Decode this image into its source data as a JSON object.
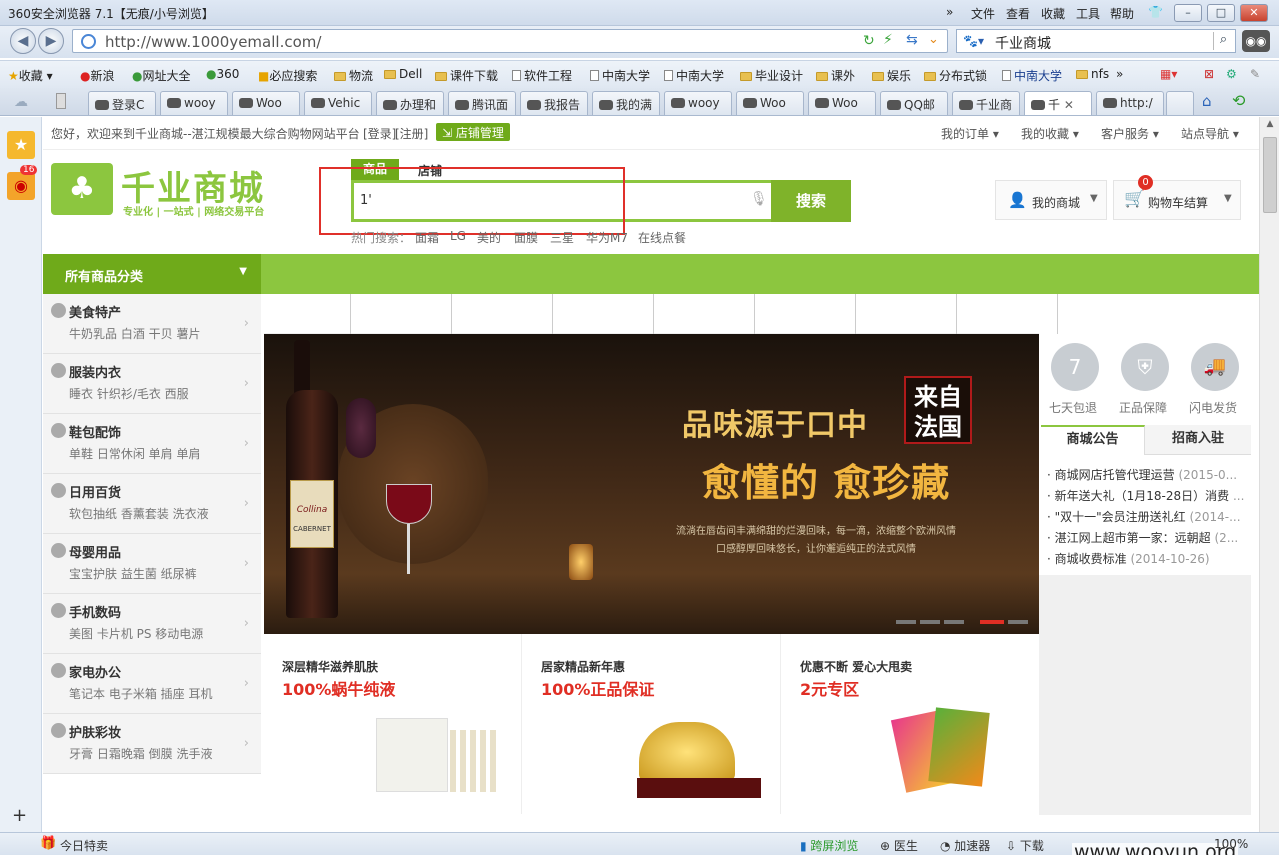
{
  "browser": {
    "title": "360安全浏览器 7.1【无痕/小号浏览】",
    "menu": [
      "»",
      "文件",
      "查看",
      "收藏",
      "工具",
      "帮助"
    ],
    "address": "http://www.1000yemall.com/",
    "search_engine_value": "千业商城",
    "favorites": [
      "收藏",
      "新浪",
      "网址大全",
      "360",
      "必应搜索",
      "物流",
      "Dell",
      "课件下载",
      "软件工程",
      "中南大学",
      "中南大学",
      "毕业设计",
      "课外",
      "娱乐",
      "分布式锁",
      "中南大学",
      "nfs",
      "»"
    ],
    "tabs": [
      "登录C",
      "wooy",
      "Woo",
      "Vehic",
      "办理和",
      "腾讯面",
      "我报告",
      "我的满",
      "wooy",
      "Woo",
      "Woo",
      "QQ邮",
      "千业商",
      "千",
      "http:/"
    ],
    "status": {
      "left": "今日特卖",
      "items": [
        "跨屏浏览",
        "医生",
        "加速器",
        "下载"
      ],
      "zoom": "100%",
      "watermark": "www.wooyun.org"
    },
    "sidebar_badge": "16"
  },
  "site": {
    "welcome": "您好，欢迎来到千业商城--湛江规模最大综合购物网站平台",
    "login": "[登录]",
    "register": "[注册]",
    "store_mgmt": "店铺管理",
    "topnav": [
      "我的订单",
      "我的收藏",
      "客户服务",
      "站点导航"
    ],
    "logo_title": "千业商城",
    "logo_slogan": "专业化 | 一站式 | 网络交易平台",
    "search_tabs": [
      "商品",
      "店铺"
    ],
    "search_value": "1'",
    "search_button": "搜索",
    "hot_label": "热门搜索：",
    "hot": [
      "面霜",
      "LG",
      "美的",
      "面膜",
      "三星",
      "华为M7",
      "在线点餐"
    ],
    "my_mall": "我的商城",
    "cart": "购物车结算",
    "cart_count": "0",
    "all_categories": "所有商品分类",
    "categories": [
      {
        "title": "美食特产",
        "subs": "牛奶乳品  白酒  干贝  薯片"
      },
      {
        "title": "服装内衣",
        "subs": "睡衣  针织衫/毛衣  西服"
      },
      {
        "title": "鞋包配饰",
        "subs": "单鞋  日常休闲  单肩  单肩"
      },
      {
        "title": "日用百货",
        "subs": "软包抽纸  香薰套装  洗衣液"
      },
      {
        "title": "母婴用品",
        "subs": "宝宝护肤  益生菌  纸尿裤"
      },
      {
        "title": "手机数码",
        "subs": "美图  卡片机  PS  移动电源"
      },
      {
        "title": "家电办公",
        "subs": "笔记本  电子米箱  插座  耳机"
      },
      {
        "title": "护肤彩妆",
        "subs": "牙膏  日霜晚霜  倒膜  洗手液"
      }
    ],
    "banner": {
      "line1": "品味源于口中",
      "stamp": "来自法国",
      "line2": "愈懂的 愈珍藏",
      "sub1": "流淌在唇齿间丰满绵甜的烂漫回味，每一滴，浓缩整个欧洲风情",
      "sub2": "口感醇厚回味悠长，让你邂逅纯正的法式风情",
      "label": "Collina",
      "cabernet": "CABERNET"
    },
    "guarantees": [
      "七天包退",
      "正品保障",
      "闪电发货"
    ],
    "notice_tabs": [
      "商城公告",
      "招商入驻"
    ],
    "notices": [
      {
        "text": "商城网店托管代理运营",
        "date": "(2015-0..."
      },
      {
        "text": "新年送大礼（1月18-28日）消费",
        "date": "..."
      },
      {
        "text": "\"双十一\"会员注册送礼红",
        "date": "(2014-..."
      },
      {
        "text": "湛江网上超市第一家：远朝超",
        "date": "(2..."
      },
      {
        "text": "商城收费标准",
        "date": "(2014-10-26)"
      }
    ],
    "promos": [
      {
        "head": "深层精华滋养肌肤",
        "big": "100%蜗牛纯液"
      },
      {
        "head": "居家精品新年惠",
        "big": "100%正品保证"
      },
      {
        "head": "优惠不断  爱心大甩卖",
        "big": "2元专区"
      }
    ]
  }
}
